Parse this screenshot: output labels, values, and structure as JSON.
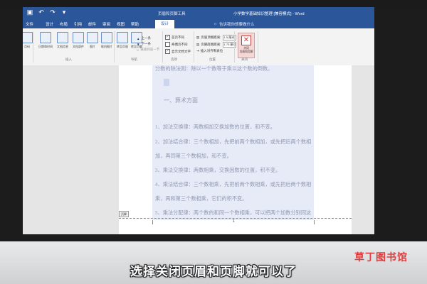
{
  "quick_access": {
    "save_icon": "save-icon",
    "undo_icon": "undo-icon",
    "redo_icon": "redo-icon",
    "customize_icon": "customize-icon"
  },
  "window": {
    "contextual_tool": "页眉和页脚工具",
    "doc_title": "小学数学基础知识整理 [兼容模式] - Word"
  },
  "tabs": [
    {
      "label": "文件"
    },
    {
      "label": "设计"
    },
    {
      "label": "布局"
    },
    {
      "label": "引用"
    },
    {
      "label": "邮件"
    },
    {
      "label": "审阅"
    },
    {
      "label": "视图"
    },
    {
      "label": "帮助"
    },
    {
      "label": "设计"
    }
  ],
  "tell_me": "告诉我你想要做什么",
  "ribbon": {
    "insert_buttons": [
      {
        "label": "页码"
      },
      {
        "label": "日期和时间"
      },
      {
        "label": "文档信息"
      },
      {
        "label": "文档部件"
      },
      {
        "label": "图片"
      },
      {
        "label": "联机图片"
      }
    ],
    "insert_group": "插入",
    "nav_buttons": [
      {
        "label": "转至页眉"
      },
      {
        "label": "转至页脚"
      }
    ],
    "nav_small": [
      "上一条",
      "下一条",
      "链接到前一节"
    ],
    "nav_group": "导航",
    "options": [
      {
        "label": "首页不同",
        "checked": true
      },
      {
        "label": "奇偶页不同",
        "checked": false
      },
      {
        "label": "显示文档文字",
        "checked": true
      }
    ],
    "options_group": "选项",
    "position": [
      {
        "label": "页眉顶端距离:",
        "value": "1.5 厘米"
      },
      {
        "label": "页脚底端距离:",
        "value": "1.75 厘米"
      },
      {
        "label": "插入对齐制表位"
      }
    ],
    "position_group": "位置",
    "close": {
      "label_line1": "关闭",
      "label_line2": "页眉和页脚"
    },
    "close_group": "关闭"
  },
  "document": {
    "lines": [
      "分数的除法则：除以一个数等于乘以这个数的倒数。",
      "一、算术方面",
      "1、加法交换律：两数相加交换加数的位置，和不变。",
      "2、加法结合律：三个数相加，先把前两个数相加，或先把后两个数相",
      "加，再同第三个数相加，和不变。",
      "3、乘法交换律：两数相乘，交换因数的位置，积不变。",
      "4、乘法结合律：三个数相乘，先把前两个数相乘，或先把后两个数相",
      "乘，再和第三个数相乘，它们的积不变。",
      "5、乘法分配律：两个数的和同一个数相乘，可以把两个加数分别同这"
    ],
    "footer_tag": "页脚",
    "page_number": "1"
  },
  "subtitle": "选择关闭页眉和页脚就可以了",
  "brand": {
    "name": "草丁图书馆",
    "color": "#e23c3c"
  },
  "colors": {
    "word_blue": "#2b579a",
    "selection": "#e7ebf8"
  }
}
